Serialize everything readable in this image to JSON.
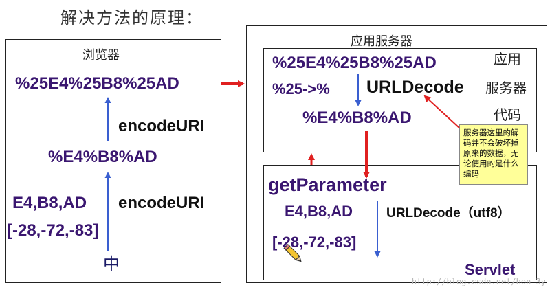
{
  "title": "解决方法的原理：",
  "browser": {
    "label": "浏览器",
    "encoded_twice": "%25E4%25B8%25AD",
    "encode_label_top": "encodeURI",
    "encoded_once": "%E4%B8%AD",
    "bytes_hex": "E4,B8,AD",
    "encode_label_bottom": "encodeURI",
    "bytes_signed": "[-28,-72,-83]",
    "char": "中"
  },
  "server": {
    "label": "应用服务器",
    "code_box": {
      "encoded_twice": "%25E4%25B8%25AD",
      "rule": "%25->%",
      "decode_label": "URLDecode",
      "encoded_once": "%E4%B8%AD",
      "side_label": [
        "应用",
        "服务器",
        "代码"
      ]
    },
    "servlet_box": {
      "get_parameter": "getParameter",
      "bytes_hex": "E4,B8,AD",
      "decode_label": "URLDecode（utf8）",
      "bytes_signed": "[-28,-72,-83]",
      "servlet_label": "Servlet"
    }
  },
  "note": "服务器这里的解码并不会破坏掉原来的数据，无论使用的是什么编码",
  "watermark": "http://blog.csdn.net/hon_3y",
  "colors": {
    "arrow_red": "#e02020",
    "arrow_blue": "#3a5fd0",
    "text_purple": "#3a1670",
    "note_bg": "#ffff99"
  }
}
